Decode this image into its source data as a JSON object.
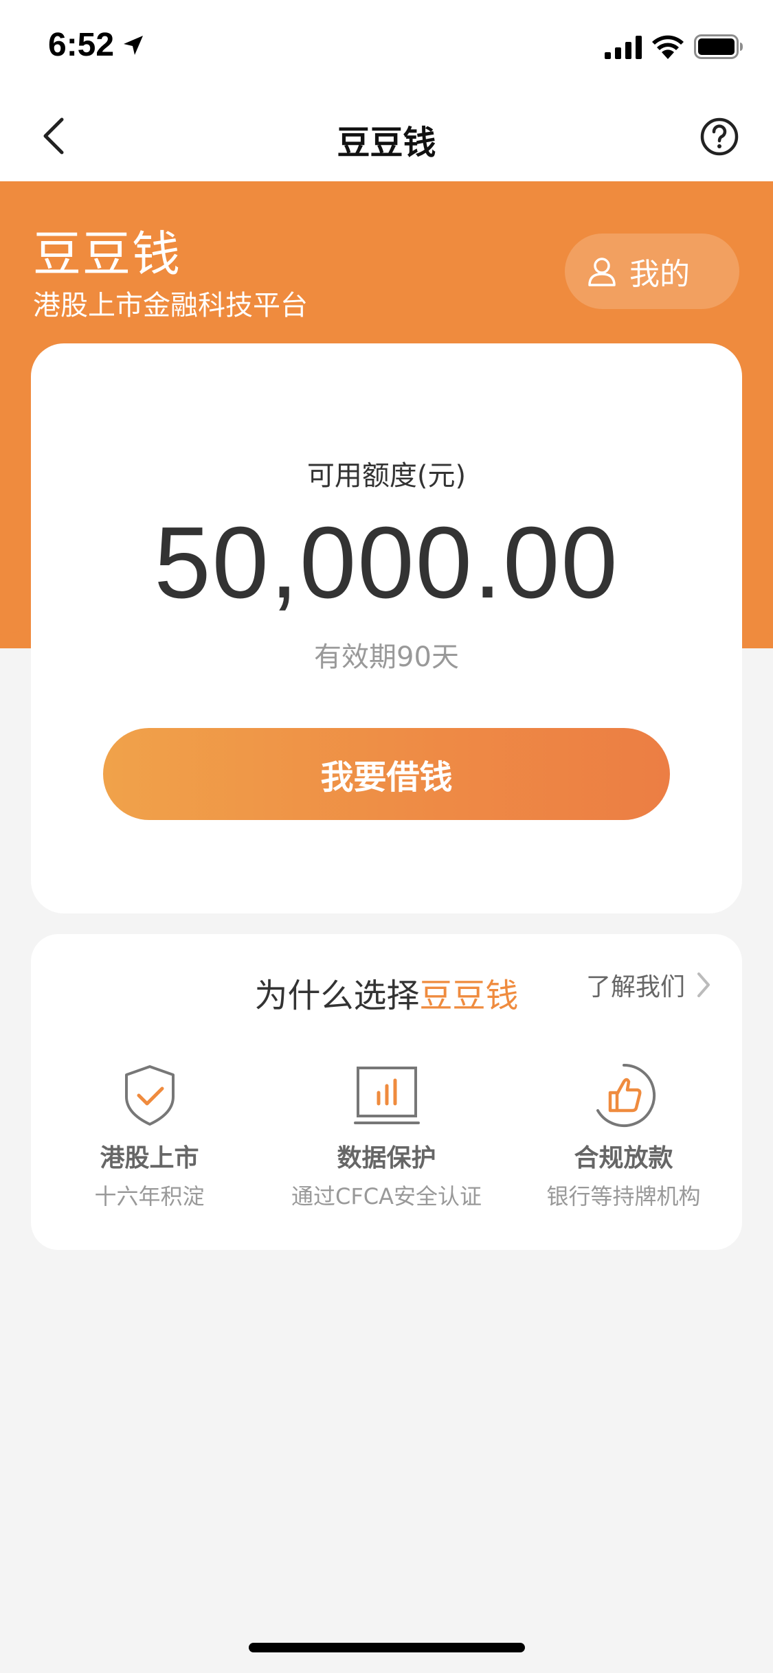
{
  "status_bar": {
    "time": "6:52"
  },
  "nav": {
    "title": "豆豆钱"
  },
  "header": {
    "brand": "豆豆钱",
    "slogan": "港股上市金融科技平台",
    "mine_label": "我的"
  },
  "credit": {
    "label": "可用额度(元)",
    "amount": "50,000.00",
    "validity": "有效期90天",
    "borrow_label": "我要借钱"
  },
  "why": {
    "title_prefix": "为什么选择",
    "title_brand": "豆豆钱",
    "about_label": "了解我们",
    "features": [
      {
        "icon": "shield-check-icon",
        "title": "港股上市",
        "subtitle": "十六年积淀"
      },
      {
        "icon": "monitor-chart-icon",
        "title": "数据保护",
        "subtitle": "通过CFCA安全认证"
      },
      {
        "icon": "thumbs-up-icon",
        "title": "合规放款",
        "subtitle": "银行等持牌机构"
      }
    ]
  },
  "colors": {
    "accent": "#ef8b3e",
    "button_start": "#f0a24a",
    "button_end": "#ec7e44",
    "background": "#f4f4f4"
  }
}
